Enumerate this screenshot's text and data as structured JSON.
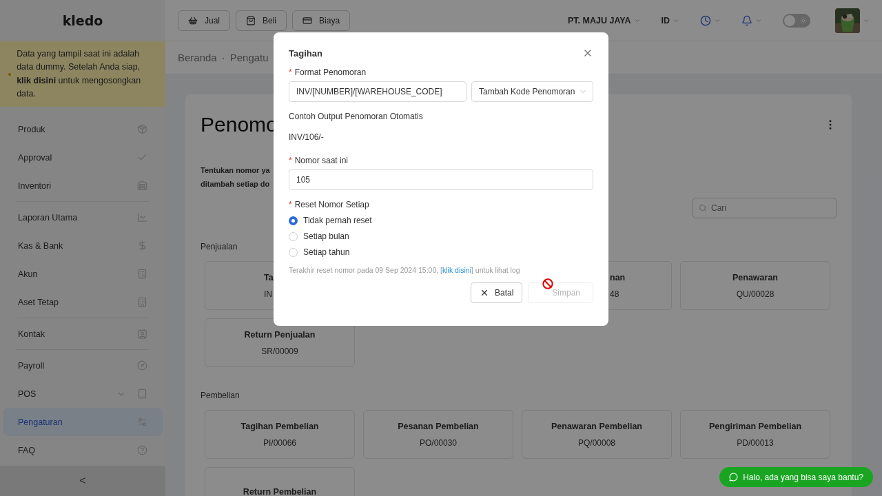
{
  "sidebar": {
    "logo": "kledo",
    "banner": "Data yang tampil saat ini adalah data dummy. Setelah Anda siap, **klik disini** untuk mengosongkan data.",
    "groups": [
      [
        {
          "label": "Produk",
          "selected": false
        },
        {
          "label": "Approval",
          "selected": false
        },
        {
          "label": "Inventori",
          "selected": false
        }
      ],
      [
        {
          "label": "Laporan Utama",
          "selected": false
        },
        {
          "label": "Kas & Bank",
          "selected": false
        },
        {
          "label": "Akun",
          "selected": false
        },
        {
          "label": "Aset Tetap",
          "selected": false
        }
      ],
      [
        {
          "label": "Kontak",
          "selected": false
        }
      ],
      [
        {
          "label": "Payroll",
          "selected": false
        },
        {
          "label": "POS",
          "selected": false,
          "expanded": false
        },
        {
          "label": "Pengaturan",
          "selected": true
        },
        {
          "label": "FAQ",
          "selected": false
        }
      ]
    ],
    "collapse": "<"
  },
  "topbar": {
    "buttons": [
      "Jual",
      "Beli",
      "Biaya"
    ],
    "company": "PT. MAJU JAYA",
    "language": "ID",
    "dark_mode": {
      "on": false
    }
  },
  "breadcrumb": {
    "separator": "·",
    "items": [
      "Beranda",
      "Pengatu"
    ]
  },
  "page": {
    "title": "Penomo",
    "description": [
      "Tentukan nomor ya",
      "ditambah setiap do"
    ],
    "search": {
      "placeholder": "Cari"
    },
    "sections": [
      {
        "title": "Penjualan",
        "cards": [
          {
            "title": "Ta",
            "code": "IN"
          },
          {
            "title": "nan",
            "code": "48"
          },
          {
            "title": "Penawaran",
            "code": "QU/00028"
          },
          {
            "title": "Return Penjualan",
            "code": "SR/00009"
          }
        ]
      },
      {
        "title": "Pembelian",
        "cards": [
          {
            "title": "Tagihan Pembelian",
            "code": "PI/00066"
          },
          {
            "title": "Pesanan Pembelian",
            "code": "PO/00030"
          },
          {
            "title": "Penawaran Pembelian",
            "code": "PQ/00008"
          },
          {
            "title": "Pengiriman Pembelian",
            "code": "PD/00013"
          },
          {
            "title": "Return Pembelian"
          }
        ]
      }
    ]
  },
  "modal": {
    "title": "Tagihan",
    "format": {
      "label": "Format Penomoran",
      "required_mark": "*",
      "value": "INV/[NUMBER]/[WAREHOUSE_CODE]",
      "select": "Tambah Kode Penomoran"
    },
    "example_label": "Contoh Output Penomoran Otomatis",
    "example_value": "INV/106/-",
    "current": {
      "label": "Nomor saat ini",
      "required_mark": "*",
      "value": "105"
    },
    "reset": {
      "label": "Reset Nomor Setiap",
      "required_mark": "*",
      "options": [
        {
          "label": "Tidak pernah reset",
          "selected": true
        },
        {
          "label": "Setiap bulan",
          "selected": false
        },
        {
          "label": "Setiap tahun",
          "selected": false
        }
      ]
    },
    "note": {
      "before": "Terakhir reset nomor pada 09 Sep 2024 15:00, [",
      "link": "klik disini",
      "after": "] untuk lihat log"
    },
    "cancel": "Batal",
    "save": {
      "label": "Simpan",
      "disabled": true
    }
  },
  "chat": "Halo, ada yang bisa saya bantu?"
}
